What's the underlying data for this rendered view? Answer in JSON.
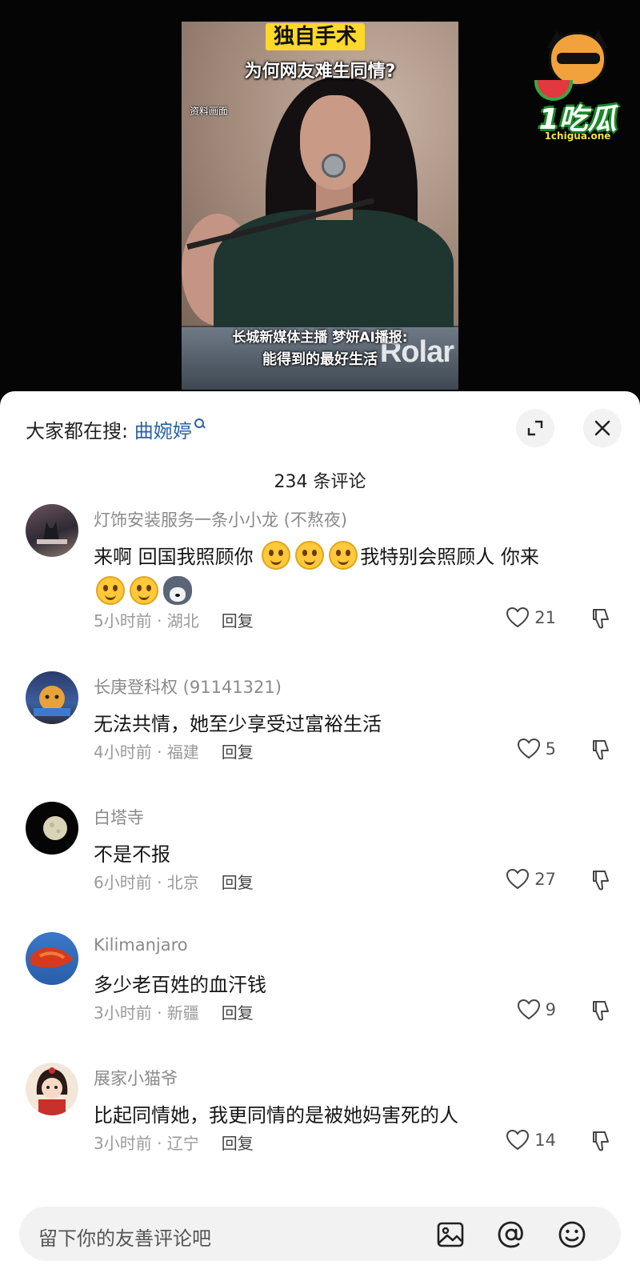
{
  "video": {
    "tag": "独自手术",
    "headline": "为何网友难生同情?",
    "note": "资料画面",
    "caption_line1": "长城新媒体主播 梦妍AI播报:",
    "caption_line2": "能得到的最好生活",
    "keyboard_brand": "Rolar"
  },
  "watermark": {
    "text": "1吃瓜",
    "domain": "1chigua.one"
  },
  "sheet": {
    "search_prefix": "大家都在搜:",
    "search_term": "曲婉婷",
    "comment_count": "234 条评论"
  },
  "comments": [
    {
      "user": "灯饰安装服务一条小小龙 (不熬夜)",
      "text_a": "来啊 回国我照顾你 ",
      "text_b": "我特别会照顾人 你来",
      "time_location": "5小时前 · 湖北",
      "reply": "回复",
      "likes": "21"
    },
    {
      "user": "长庚登科权 (91141321)",
      "text": "无法共情，她至少享受过富裕生活",
      "time_location": "4小时前 · 福建",
      "reply": "回复",
      "likes": "5"
    },
    {
      "user": "白塔寺",
      "text": "不是不报",
      "time_location": "6小时前 · 北京",
      "reply": "回复",
      "likes": "27"
    },
    {
      "user": "Kilimanjaro",
      "text": "多少老百姓的血汗钱",
      "time_location": "3小时前 · 新疆",
      "reply": "回复",
      "likes": "9"
    },
    {
      "user": "展家小猫爷",
      "text": "比起同情她，我更同情的是被她妈害死的人",
      "time_location": "3小时前 · 辽宁",
      "reply": "回复",
      "likes": "14"
    }
  ],
  "input": {
    "placeholder": "留下你的友善评论吧"
  }
}
